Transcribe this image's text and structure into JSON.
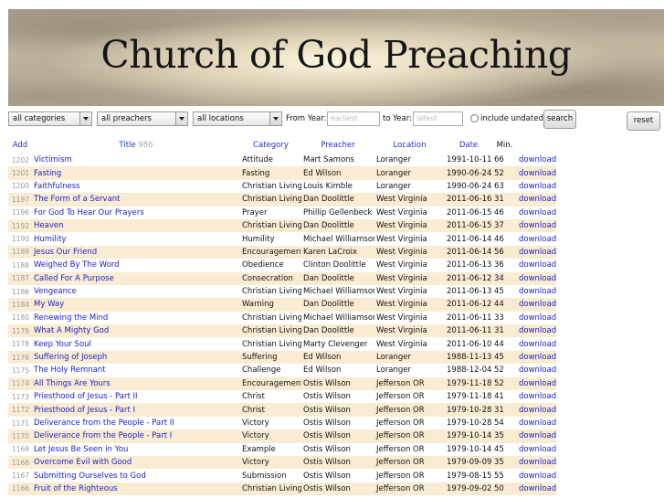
{
  "site_title": "Church of God Preaching",
  "filters": {
    "category": "all categories",
    "preacher": "all preachers",
    "location": "all locations",
    "from_year_label": "From Year:",
    "from_year_placeholder": "earliest",
    "to_year_label": "to Year:",
    "to_year_placeholder": "latest",
    "include_undated_label": "include undated",
    "search_label": "search",
    "reset_label": "reset"
  },
  "table": {
    "headers": {
      "add": "Add",
      "title": "Title",
      "count": "986",
      "category": "Category",
      "preacher": "Preacher",
      "location": "Location",
      "date": "Date",
      "min": "Min."
    },
    "rows": [
      {
        "id": "1202",
        "title": "Victimism",
        "category": "Attitude",
        "preacher": "Mart Samons",
        "location": "Loranger",
        "date": "1991-10-11",
        "min": "66",
        "action": "download"
      },
      {
        "id": "1201",
        "title": "Fasting",
        "category": "Fasting",
        "preacher": "Ed Wilson",
        "location": "Loranger",
        "date": "1990-06-24",
        "min": "52",
        "action": "download"
      },
      {
        "id": "1200",
        "title": "Faithfulness",
        "category": "Christian Living",
        "preacher": "Louis Kimble",
        "location": "Loranger",
        "date": "1990-06-24",
        "min": "63",
        "action": "download"
      },
      {
        "id": "1197",
        "title": "The Form of a Servant",
        "category": "Christian Living",
        "preacher": "Dan Doolittle",
        "location": "West Virginia",
        "date": "2011-06-16",
        "min": "31",
        "action": "download"
      },
      {
        "id": "1196",
        "title": "For God To Hear Our Prayers",
        "category": "Prayer",
        "preacher": "Phillip Gellenbeck",
        "location": "West Virginia",
        "date": "2011-06-15",
        "min": "46",
        "action": "download"
      },
      {
        "id": "1192",
        "title": "Heaven",
        "category": "Christian Living",
        "preacher": "Dan Doolittle",
        "location": "West Virginia",
        "date": "2011-06-15",
        "min": "37",
        "action": "download"
      },
      {
        "id": "1190",
        "title": "Humility",
        "category": "Humility",
        "preacher": "Michael Williamson",
        "location": "West Virginia",
        "date": "2011-06-14",
        "min": "46",
        "action": "download"
      },
      {
        "id": "1189",
        "title": "Jesus Our Friend",
        "category": "Encouragement",
        "preacher": "Karen LaCroix",
        "location": "West Virginia",
        "date": "2011-06-14",
        "min": "56",
        "action": "download"
      },
      {
        "id": "1188",
        "title": "Weighed By The Word",
        "category": "Obedience",
        "preacher": "Clinton Doolittle",
        "location": "West Virginia",
        "date": "2011-06-13",
        "min": "36",
        "action": "download"
      },
      {
        "id": "1187",
        "title": "Called For A Purpose",
        "category": "Consecration",
        "preacher": "Dan Doolittle",
        "location": "West Virginia",
        "date": "2011-06-12",
        "min": "34",
        "action": "download"
      },
      {
        "id": "1186",
        "title": "Vengeance",
        "category": "Christian Living",
        "preacher": "Michael Williamson",
        "location": "West Virginia",
        "date": "2011-06-13",
        "min": "45",
        "action": "download"
      },
      {
        "id": "1184",
        "title": "My Way",
        "category": "Warning",
        "preacher": "Dan Doolittle",
        "location": "West Virginia",
        "date": "2011-06-12",
        "min": "44",
        "action": "download"
      },
      {
        "id": "1180",
        "title": "Renewing the Mind",
        "category": "Christian Living",
        "preacher": "Michael Williamson",
        "location": "West Virginia",
        "date": "2011-06-11",
        "min": "33",
        "action": "download"
      },
      {
        "id": "1179",
        "title": "What A Mighty God",
        "category": "Christian Living",
        "preacher": "Dan Doolittle",
        "location": "West Virginia",
        "date": "2011-06-11",
        "min": "31",
        "action": "download"
      },
      {
        "id": "1178",
        "title": "Keep Your Soul",
        "category": "Christian Living",
        "preacher": "Marty Clevenger",
        "location": "West Virginia",
        "date": "2011-06-10",
        "min": "44",
        "action": "download"
      },
      {
        "id": "1176",
        "title": "Suffering of Joseph",
        "category": "Suffering",
        "preacher": "Ed Wilson",
        "location": "Loranger",
        "date": "1988-11-13",
        "min": "45",
        "action": "download"
      },
      {
        "id": "1175",
        "title": "The Holy Remnant",
        "category": "Challenge",
        "preacher": "Ed Wilson",
        "location": "Loranger",
        "date": "1988-12-04",
        "min": "52",
        "action": "download"
      },
      {
        "id": "1174",
        "title": "All Things Are Yours",
        "category": "Encouragement",
        "preacher": "Ostis Wilson",
        "location": "Jefferson OR",
        "date": "1979-11-18",
        "min": "52",
        "action": "download"
      },
      {
        "id": "1173",
        "title": "Priesthood of Jesus - Part II",
        "category": "Christ",
        "preacher": "Ostis Wilson",
        "location": "Jefferson OR",
        "date": "1979-11-18",
        "min": "41",
        "action": "download"
      },
      {
        "id": "1172",
        "title": "Priesthood of Jesus - Part I",
        "category": "Christ",
        "preacher": "Ostis Wilson",
        "location": "Jefferson OR",
        "date": "1979-10-28",
        "min": "31",
        "action": "download"
      },
      {
        "id": "1171",
        "title": "Deliverance from the People - Part II",
        "category": "Victory",
        "preacher": "Ostis Wilson",
        "location": "Jefferson OR",
        "date": "1979-10-28",
        "min": "54",
        "action": "download"
      },
      {
        "id": "1170",
        "title": "Deliverance from the People - Part I",
        "category": "Victory",
        "preacher": "Ostis Wilson",
        "location": "Jefferson OR",
        "date": "1979-10-14",
        "min": "35",
        "action": "download"
      },
      {
        "id": "1169",
        "title": "Let Jesus Be Seen in You",
        "category": "Example",
        "preacher": "Ostis Wilson",
        "location": "Jefferson OR",
        "date": "1979-10-14",
        "min": "45",
        "action": "download"
      },
      {
        "id": "1168",
        "title": "Overcome Evil with Good",
        "category": "Victory",
        "preacher": "Ostis Wilson",
        "location": "Jefferson OR",
        "date": "1979-09-09",
        "min": "35",
        "action": "download"
      },
      {
        "id": "1167",
        "title": "Submitting Ourselves to God",
        "category": "Submission",
        "preacher": "Ostis Wilson",
        "location": "Jefferson OR",
        "date": "1979-08-15",
        "min": "55",
        "action": "download"
      },
      {
        "id": "1166",
        "title": "Fruit of the Righteous",
        "category": "Christian Living",
        "preacher": "Ostis Wilson",
        "location": "Jefferson OR",
        "date": "1979-09-02",
        "min": "50",
        "action": "download"
      }
    ]
  }
}
